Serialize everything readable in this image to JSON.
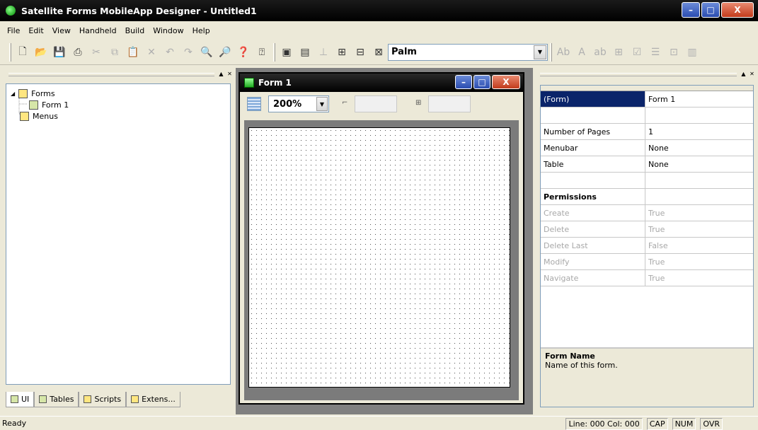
{
  "window": {
    "title": "Satellite Forms MobileApp Designer - Untitled1",
    "minimize": "–",
    "maximize": "□",
    "close": "X"
  },
  "menubar": {
    "items": [
      "File",
      "Edit",
      "View",
      "Handheld",
      "Build",
      "Window",
      "Help"
    ]
  },
  "toolbar": {
    "device": "Palm"
  },
  "tree": {
    "root": "Forms",
    "child": "Form 1",
    "menus": "Menus"
  },
  "tabs": [
    {
      "label": "UI"
    },
    {
      "label": "Tables"
    },
    {
      "label": "Scripts"
    },
    {
      "label": "Extens..."
    }
  ],
  "form_window": {
    "title": "Form 1",
    "zoom": "200%"
  },
  "properties": {
    "rows": [
      {
        "name": "(Form)",
        "value": "Form 1",
        "selected": true
      },
      {
        "name": "",
        "value": ""
      },
      {
        "name": "Number of Pages",
        "value": "1"
      },
      {
        "name": "Menubar",
        "value": "None"
      },
      {
        "name": "Table",
        "value": "None"
      },
      {
        "name": "",
        "value": ""
      },
      {
        "name": "Permissions",
        "value": "",
        "bold": true
      },
      {
        "name": "Create",
        "value": "True",
        "disabled": true
      },
      {
        "name": "Delete",
        "value": "True",
        "disabled": true
      },
      {
        "name": "Delete Last",
        "value": "False",
        "disabled": true
      },
      {
        "name": "Modify",
        "value": "True",
        "disabled": true
      },
      {
        "name": "Navigate",
        "value": "True",
        "disabled": true
      }
    ],
    "description_title": "Form Name",
    "description_text": "Name of this form."
  },
  "status": {
    "text": "Ready",
    "position": "Line: 000  Col: 000",
    "cap": "CAP",
    "num": "NUM",
    "ovr": "OVR"
  }
}
